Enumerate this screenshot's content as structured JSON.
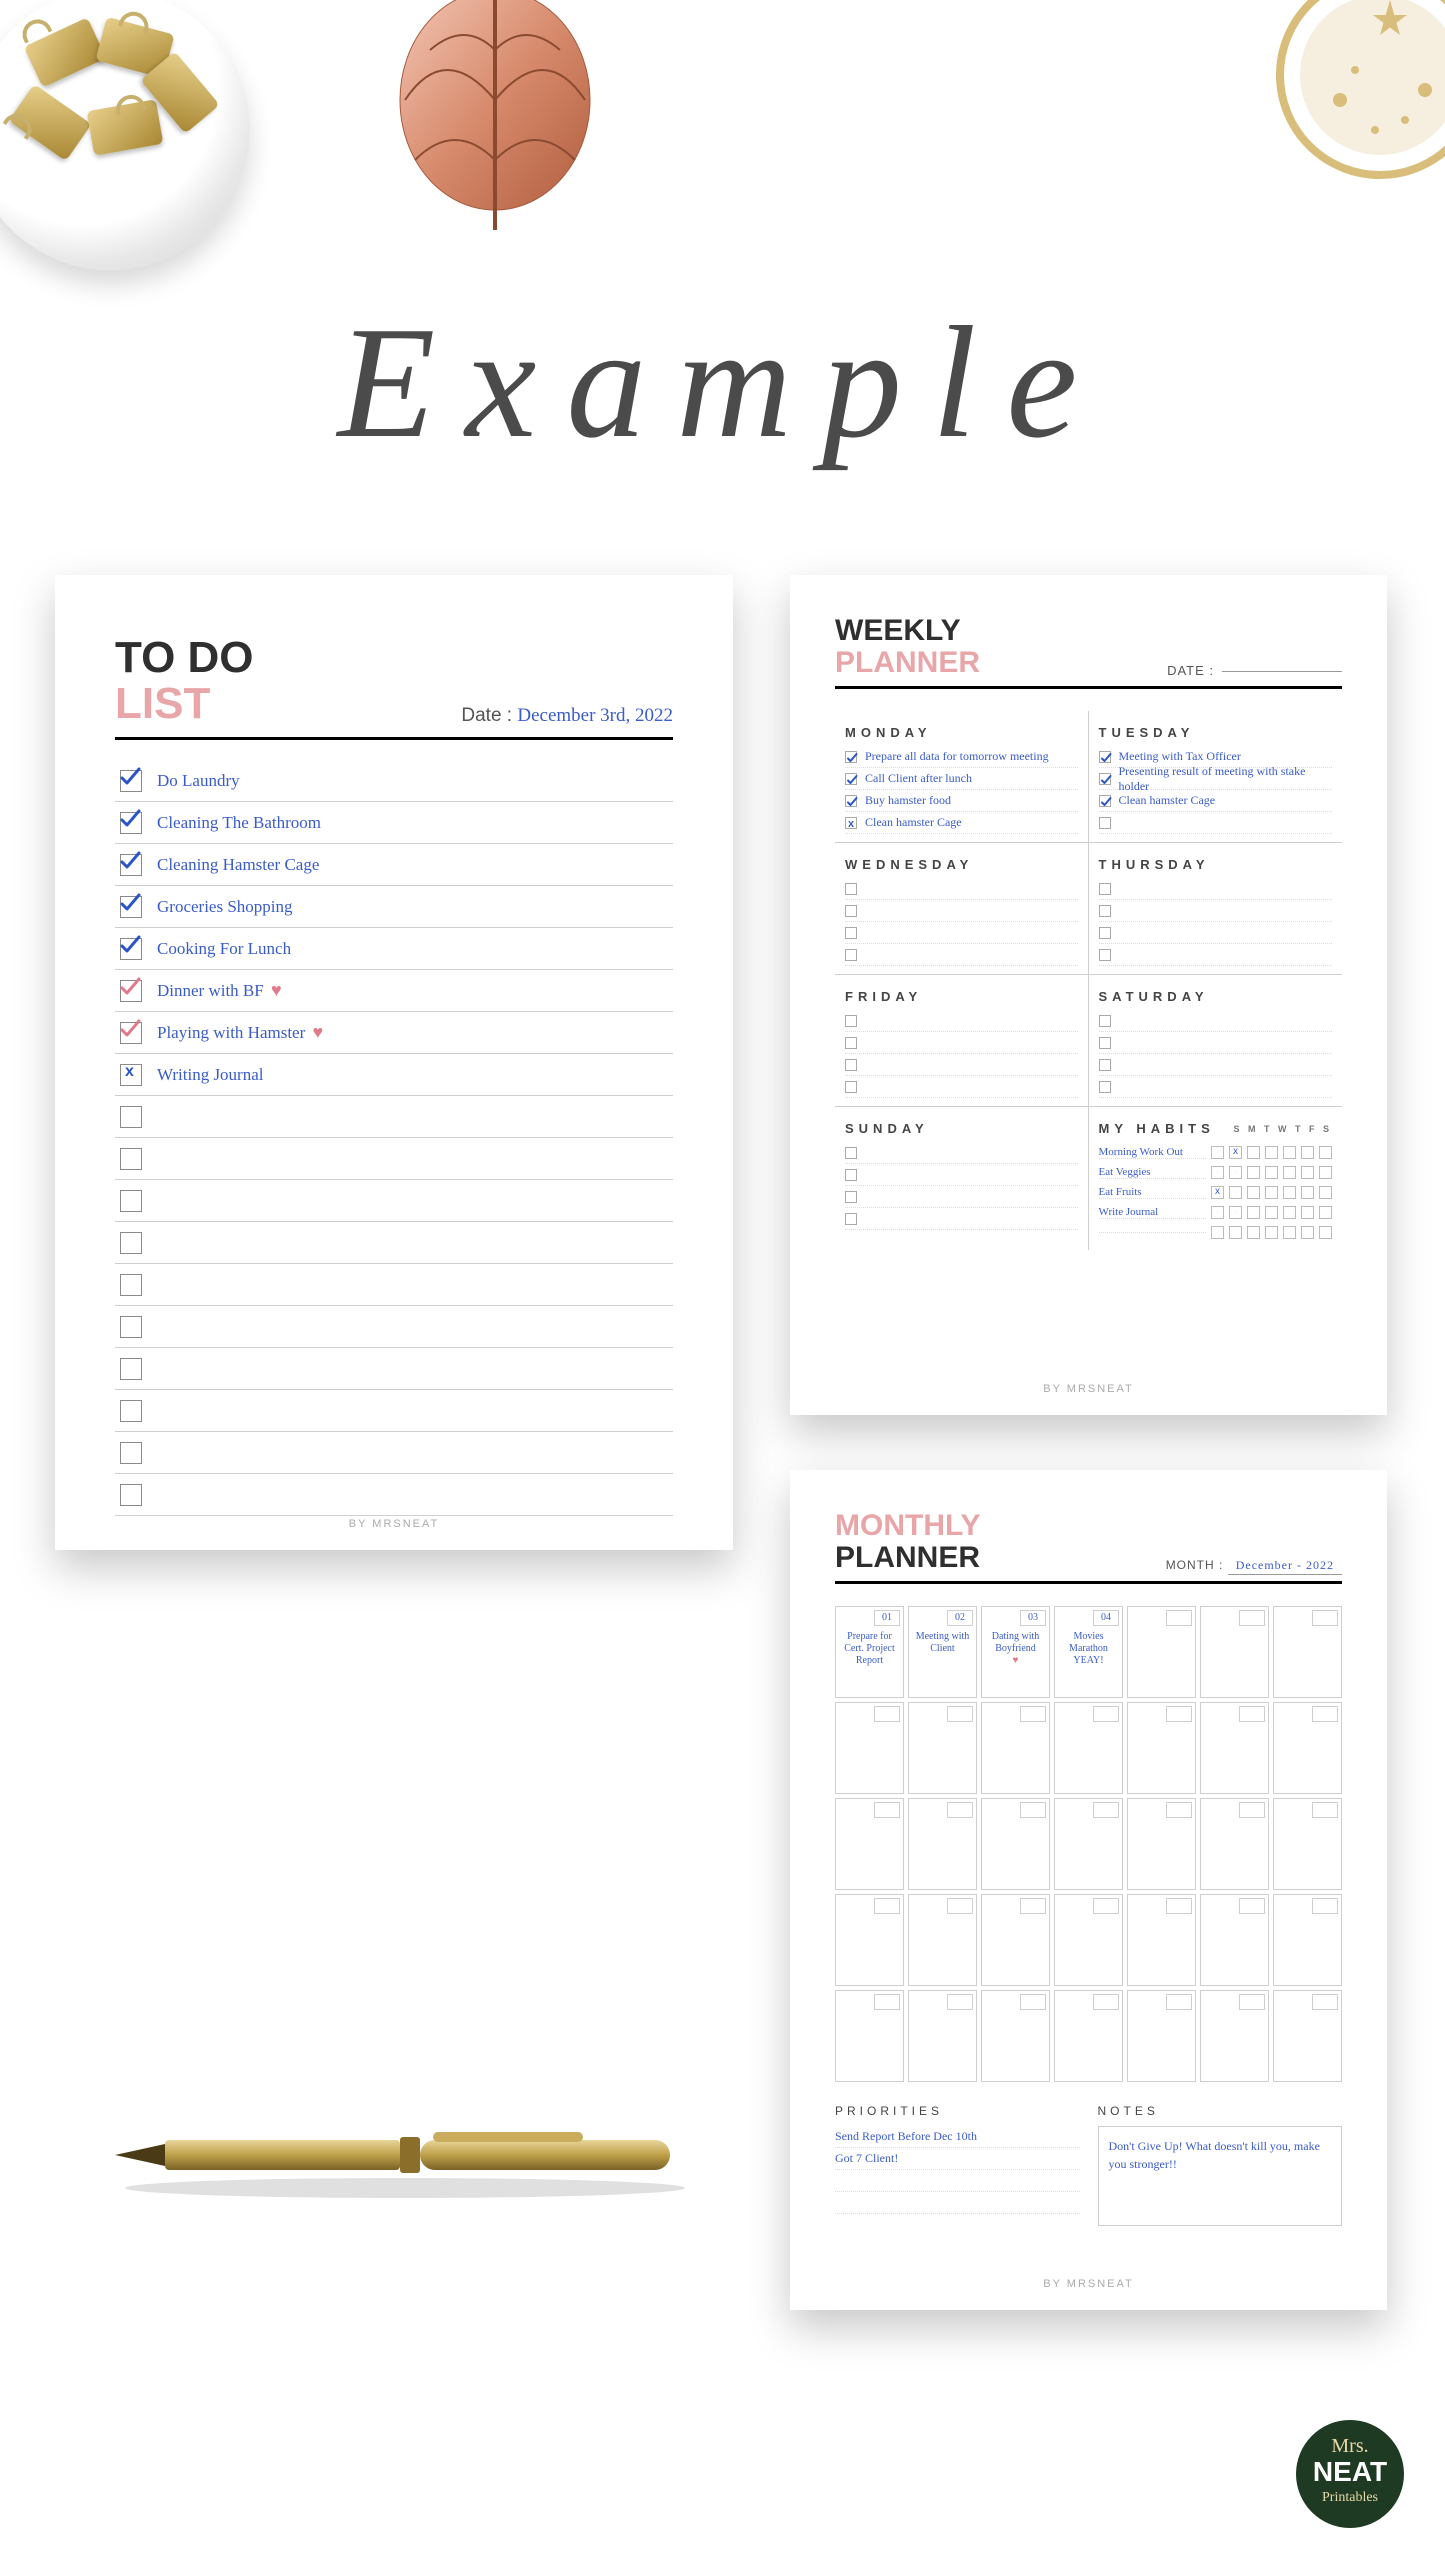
{
  "title": "Example",
  "footer": "BY MRSNEAT",
  "logo": {
    "line1": "Mrs.",
    "line2": "NEAT",
    "line3": "Printables"
  },
  "todo": {
    "title1": "TO DO",
    "title2": "LIST",
    "date_label": "Date :",
    "date_value": "December 3rd, 2022",
    "items": [
      {
        "text": "Do Laundry",
        "checked": true,
        "mark": "check"
      },
      {
        "text": "Cleaning The Bathroom",
        "checked": true,
        "mark": "check"
      },
      {
        "text": "Cleaning Hamster Cage",
        "checked": true,
        "mark": "check"
      },
      {
        "text": "Groceries Shopping",
        "checked": true,
        "mark": "check"
      },
      {
        "text": "Cooking For Lunch",
        "checked": true,
        "mark": "check"
      },
      {
        "text": "Dinner with BF",
        "checked": true,
        "mark": "check",
        "heart": true
      },
      {
        "text": "Playing with Hamster",
        "checked": true,
        "mark": "check",
        "heart": true
      },
      {
        "text": "Writing Journal",
        "checked": true,
        "mark": "x"
      }
    ],
    "blank_rows": 10
  },
  "weekly": {
    "title1": "WEEKLY",
    "title2": "PLANNER",
    "date_label": "DATE :",
    "days": [
      {
        "name": "MONDAY",
        "items": [
          {
            "text": "Prepare all data for tomorrow meeting",
            "mark": "check"
          },
          {
            "text": "Call Client after lunch",
            "mark": "check"
          },
          {
            "text": "Buy hamster food",
            "mark": "check"
          },
          {
            "text": "Clean hamster Cage",
            "mark": "x"
          }
        ]
      },
      {
        "name": "TUESDAY",
        "items": [
          {
            "text": "Meeting with Tax Officer",
            "mark": "check"
          },
          {
            "text": "Presenting result of meeting with stake holder",
            "mark": "check"
          },
          {
            "text": "Clean hamster Cage",
            "mark": "check"
          },
          {
            "text": "",
            "mark": "box"
          }
        ]
      },
      {
        "name": "WEDNESDAY",
        "items": [
          {
            "text": "",
            "mark": "box"
          },
          {
            "text": "",
            "mark": "box"
          },
          {
            "text": "",
            "mark": "box"
          },
          {
            "text": "",
            "mark": "box"
          }
        ]
      },
      {
        "name": "THURSDAY",
        "items": [
          {
            "text": "",
            "mark": "box"
          },
          {
            "text": "",
            "mark": "box"
          },
          {
            "text": "",
            "mark": "box"
          },
          {
            "text": "",
            "mark": "box"
          }
        ]
      },
      {
        "name": "FRIDAY",
        "items": [
          {
            "text": "",
            "mark": "box"
          },
          {
            "text": "",
            "mark": "box"
          },
          {
            "text": "",
            "mark": "box"
          },
          {
            "text": "",
            "mark": "box"
          }
        ]
      },
      {
        "name": "SATURDAY",
        "items": [
          {
            "text": "",
            "mark": "box"
          },
          {
            "text": "",
            "mark": "box"
          },
          {
            "text": "",
            "mark": "box"
          },
          {
            "text": "",
            "mark": "box"
          }
        ]
      },
      {
        "name": "SUNDAY",
        "items": [
          {
            "text": "",
            "mark": "box"
          },
          {
            "text": "",
            "mark": "box"
          },
          {
            "text": "",
            "mark": "box"
          },
          {
            "text": "",
            "mark": "box"
          }
        ]
      }
    ],
    "habits": {
      "title": "MY HABITS",
      "weekdays": "S M T W T F S",
      "rows": [
        {
          "label": "Morning Work Out",
          "marks": [
            "check",
            "x",
            "",
            "",
            "",
            "",
            ""
          ]
        },
        {
          "label": "Eat Veggies",
          "marks": [
            "check",
            "check",
            "",
            "",
            "",
            "",
            ""
          ]
        },
        {
          "label": "Eat Fruits",
          "marks": [
            "x",
            "check",
            "",
            "",
            "",
            "",
            ""
          ]
        },
        {
          "label": "Write Journal",
          "marks": [
            "check",
            "check",
            "",
            "",
            "",
            "",
            ""
          ]
        },
        {
          "label": "",
          "marks": [
            "",
            "",
            "",
            "",
            "",
            "",
            ""
          ]
        }
      ]
    }
  },
  "monthly": {
    "title1": "MONTHLY",
    "title2": "PLANNER",
    "month_label": "MONTH :",
    "month_value": "December - 2022",
    "cells": [
      {
        "num": "01",
        "text": "Prepare for Cert. Project Report"
      },
      {
        "num": "02",
        "text": "Meeting with Client"
      },
      {
        "num": "03",
        "text": "Dating with Boyfriend",
        "heart": true
      },
      {
        "num": "04",
        "text": "Movies Marathon YEAY!"
      },
      {
        "num": ""
      },
      {
        "num": ""
      },
      {
        "num": ""
      },
      {
        "num": ""
      },
      {
        "num": ""
      },
      {
        "num": ""
      },
      {
        "num": ""
      },
      {
        "num": ""
      },
      {
        "num": ""
      },
      {
        "num": ""
      },
      {
        "num": ""
      },
      {
        "num": ""
      },
      {
        "num": ""
      },
      {
        "num": ""
      },
      {
        "num": ""
      },
      {
        "num": ""
      },
      {
        "num": ""
      },
      {
        "num": ""
      },
      {
        "num": ""
      },
      {
        "num": ""
      },
      {
        "num": ""
      },
      {
        "num": ""
      },
      {
        "num": ""
      },
      {
        "num": ""
      },
      {
        "num": ""
      },
      {
        "num": ""
      },
      {
        "num": ""
      },
      {
        "num": ""
      },
      {
        "num": ""
      },
      {
        "num": ""
      },
      {
        "num": ""
      }
    ],
    "priorities": {
      "title": "PRIORITIES",
      "items": [
        "Send Report Before Dec 10th",
        "Got 7 Client!",
        "",
        ""
      ]
    },
    "notes": {
      "title": "NOTES",
      "text": "Don't Give Up! What doesn't kill you, make you stronger!!"
    }
  }
}
